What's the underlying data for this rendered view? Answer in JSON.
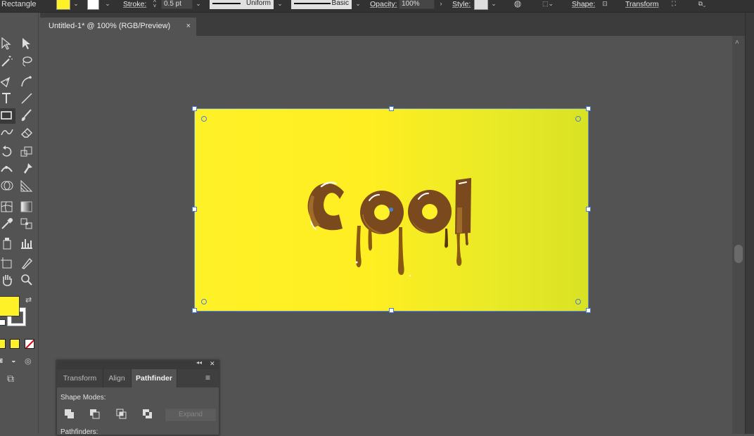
{
  "control_bar": {
    "selection_type": "Rectangle",
    "fill_color": "#fff128",
    "stroke_label": "Stroke:",
    "stroke_weight": "0.5 pt",
    "stroke_profile": "Uniform",
    "brush": "Basic",
    "opacity_label": "Opacity:",
    "opacity_value": "100%",
    "style_label": "Style:",
    "shape_label": "Shape:",
    "transform_label": "Transform"
  },
  "document": {
    "tab_title": "Untitled-1* @ 100% (RGB/Preview)",
    "close_glyph": "×"
  },
  "artboard": {
    "text": "Cool",
    "gradient_start": "#fff128",
    "gradient_end": "#d9e224",
    "chocolate_color": "#7a4a1e",
    "drip_color": "#8a5a10"
  },
  "toolbar": {
    "tools": [
      "selection-icon",
      "direct-selection-icon",
      "magic-wand-icon",
      "lasso-icon",
      "pen-icon",
      "curvature-icon",
      "type-icon",
      "line-icon",
      "rectangle-icon",
      "paintbrush-icon",
      "shaper-icon",
      "eraser-icon",
      "rotate-icon",
      "scale-icon",
      "width-icon",
      "puppet-warp-icon",
      "shape-builder-icon",
      "perspective-icon",
      "mesh-icon",
      "gradient-icon",
      "eyedropper-icon",
      "blend-icon",
      "symbol-sprayer-icon",
      "graph-icon",
      "artboard-icon",
      "slice-icon",
      "hand-icon",
      "zoom-icon"
    ],
    "fill_swatch": "#fff128",
    "stroke_swatch": "#ffffff"
  },
  "panel": {
    "tabs": [
      "Transform",
      "Align",
      "Pathfinder"
    ],
    "active_tab": "Pathfinder",
    "shape_modes_label": "Shape Modes:",
    "expand_label": "Expand",
    "pathfinders_label": "Pathfinders:",
    "collapse_glyph": "◂◂",
    "close_glyph": "✕",
    "menu_glyph": "≡"
  }
}
